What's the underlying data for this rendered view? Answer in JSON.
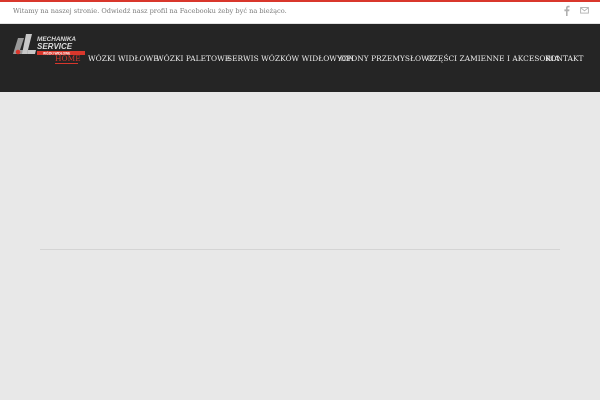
{
  "infobar": {
    "text": "Witamy na naszej stronie. Odwiedź nasz profil na Facebooku żeby być na bieżąco.",
    "social": [
      "facebook-icon",
      "mail-icon"
    ]
  },
  "logo": {
    "line1": "MECHANIKA",
    "line2": "SERVICE",
    "line3": "WÓZKI WIDŁOWE"
  },
  "nav": {
    "items": [
      {
        "label": "HOME",
        "active": true
      },
      {
        "label": "WÓZKI WIDŁOWE"
      },
      {
        "label": "WÓZKI PALETOWE"
      },
      {
        "label": "SERWIS WÓZKÓW WIDŁOWYCH"
      },
      {
        "label": "OPONY PRZEMYSŁOWE"
      },
      {
        "label": "CZĘŚCI ZAMIENNE I AKCESORIA"
      },
      {
        "label": "KONTAKT"
      }
    ]
  },
  "colors": {
    "accent": "#d9372c",
    "header": "#252525",
    "background": "#e8e8e8",
    "infobar": "#ffffff"
  }
}
